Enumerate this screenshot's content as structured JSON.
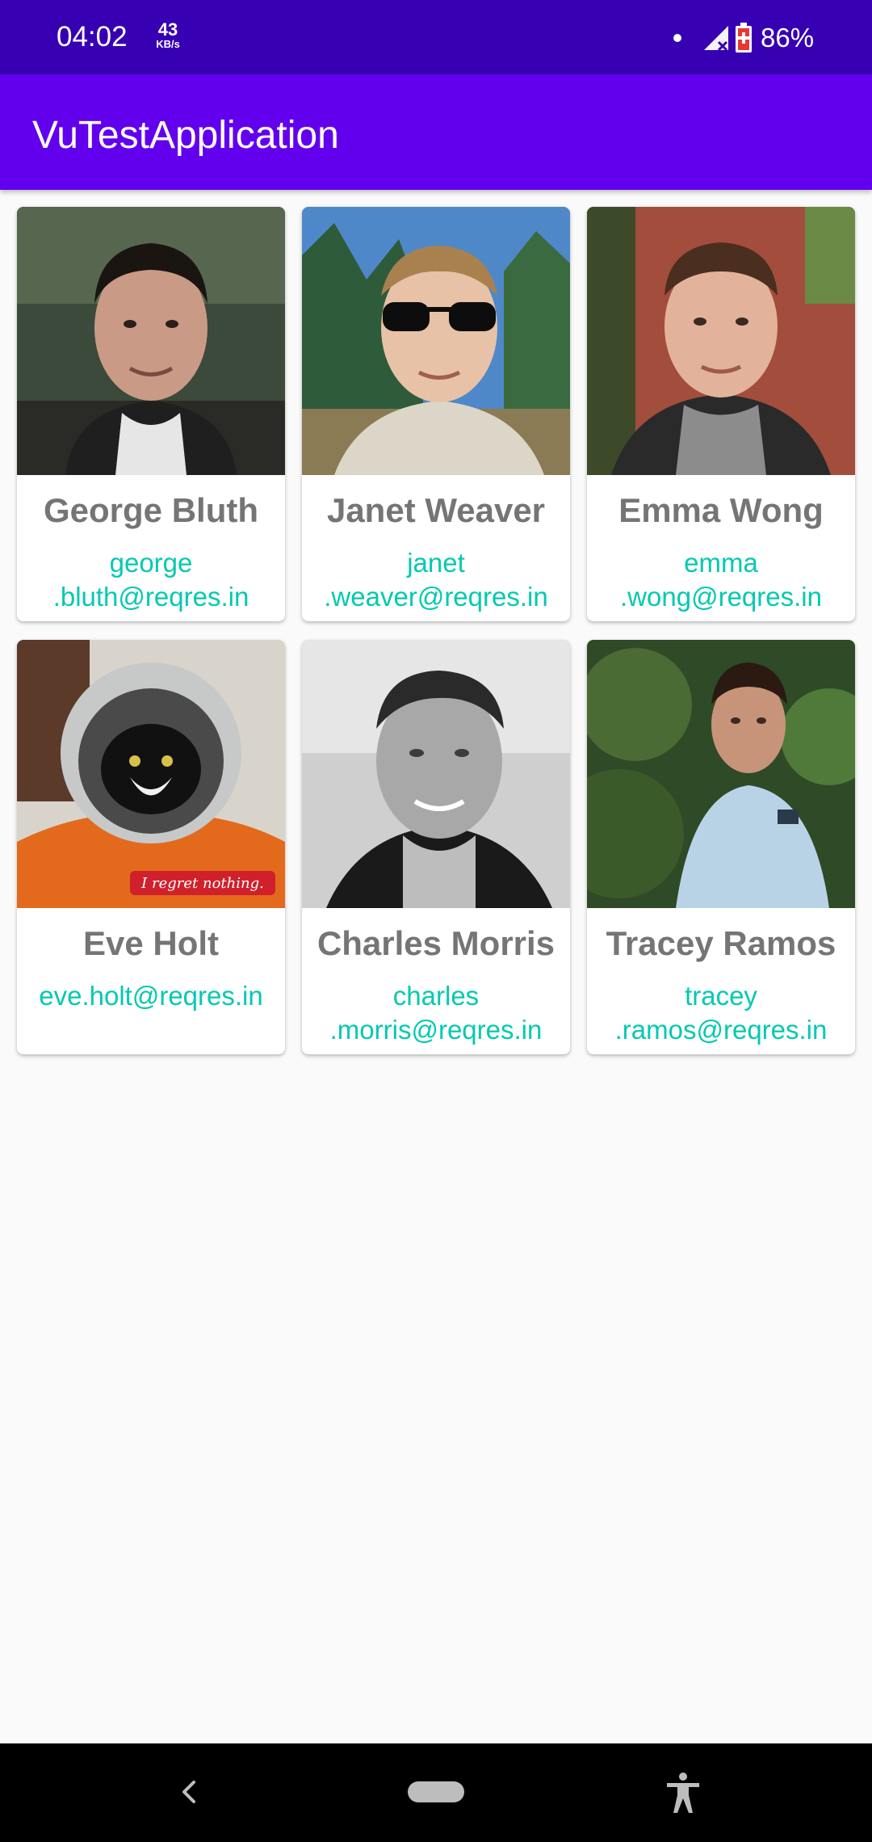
{
  "status_bar": {
    "time": "04:02",
    "net_speed_value": "43",
    "net_speed_unit": "KB/s",
    "battery_percent": "86%"
  },
  "app_bar": {
    "title": "VuTestApplication",
    "color": "#6200ee",
    "status_color": "#3700b3"
  },
  "users": [
    {
      "name": "George Bluth",
      "email": "george\n.bluth@reqres.in",
      "avatar": "person-photo"
    },
    {
      "name": "Janet Weaver",
      "email": "janet\n.weaver@reqres.in",
      "avatar": "person-photo-sunglasses"
    },
    {
      "name": "Emma Wong",
      "email": "emma\n.wong@reqres.in",
      "avatar": "person-photo"
    },
    {
      "name": "Eve Holt",
      "email": "eve.holt@reqres.in",
      "avatar": "cat-astronaut-photo"
    },
    {
      "name": "Charles Morris",
      "email": "charles\n.morris@reqres.in",
      "avatar": "person-photo-bw"
    },
    {
      "name": "Tracey Ramos",
      "email": "tracey\n.ramos@reqres.in",
      "avatar": "person-photo"
    }
  ],
  "avatar_caption": "I regret nothing.",
  "colors": {
    "name_text": "#757575",
    "email_text": "#03c9b0",
    "background": "#fafafa"
  },
  "nav_bar": {
    "back_icon": "back-chevron-icon",
    "home_icon": "home-pill-icon",
    "accessibility_icon": "accessibility-icon"
  }
}
